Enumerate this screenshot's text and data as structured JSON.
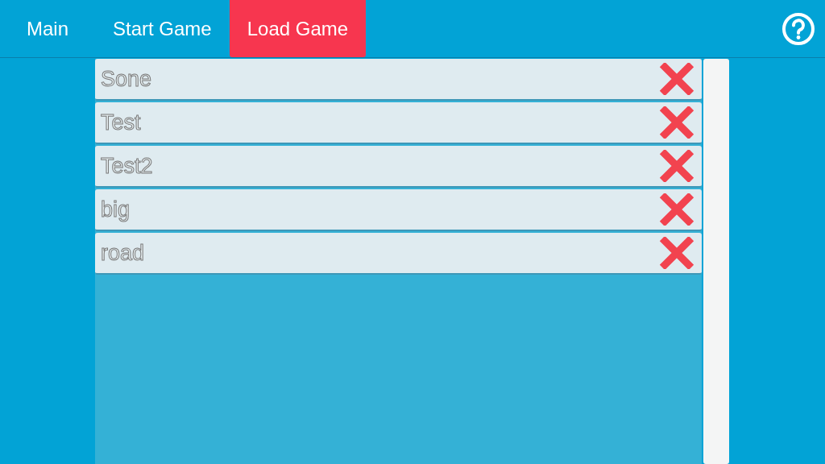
{
  "tabs": [
    {
      "label": "Main",
      "selected": false
    },
    {
      "label": "Start Game",
      "selected": false
    },
    {
      "label": "Load Game",
      "selected": true
    }
  ],
  "saves": [
    {
      "name": "Sone"
    },
    {
      "name": "Test"
    },
    {
      "name": "Test2"
    },
    {
      "name": "big"
    },
    {
      "name": "road"
    }
  ]
}
